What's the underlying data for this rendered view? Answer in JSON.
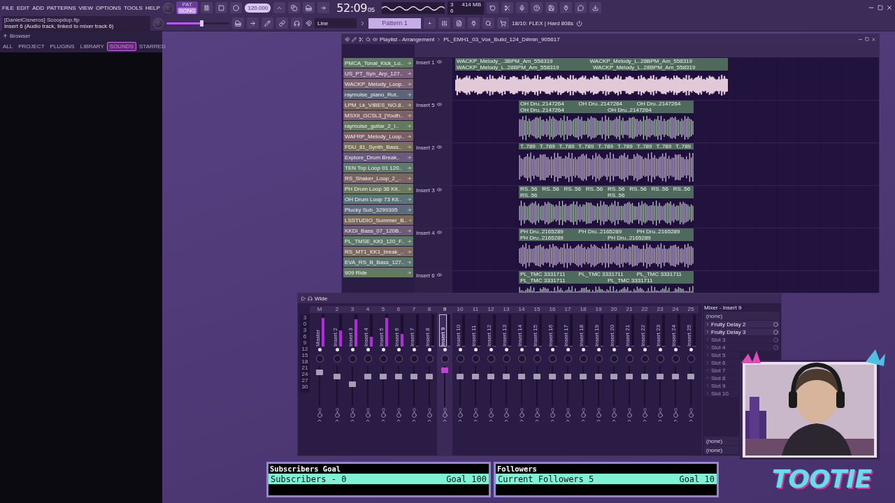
{
  "menu": [
    "FILE",
    "EDIT",
    "ADD",
    "PATTERNS",
    "VIEW",
    "OPTIONS",
    "TOOLS",
    "HELP"
  ],
  "transport": {
    "modes": [
      {
        "label": "PAT",
        "selected": false
      },
      {
        "label": "SONG",
        "selected": true
      }
    ],
    "tempo": "120.000",
    "time": "52:09",
    "time_sub": "05",
    "cpu": "3",
    "memory": "414 MB",
    "voices": "6"
  },
  "hint": {
    "project": "[DanielCisneros] Scoopdup.flp",
    "text": "Insert 6 (Audio track, linked to mixer track 6)"
  },
  "master_volume": {
    "level": 0.55
  },
  "snap": "Line",
  "pattern": "Pattern 1",
  "pattern_add": "+",
  "news": "18/10: FLEX | Hard 808s",
  "browser": {
    "title": "Browser",
    "tabs": [
      {
        "label": "ALL",
        "selected": false
      },
      {
        "label": "PROJECT",
        "selected": false
      },
      {
        "label": "PLUGINS",
        "selected": false
      },
      {
        "label": "LIBRARY",
        "selected": false
      },
      {
        "label": "SOUNDS",
        "selected": true
      },
      {
        "label": "STARRED",
        "selected": false
      }
    ]
  },
  "playlist": {
    "title": "Playlist - Arrangement",
    "project": "PL_EMH1_03_Vox_Build_124_D#min_905617",
    "clips": [
      {
        "name": "PMCA_Tonal_Kick_Lo..",
        "color": "#5f7a63"
      },
      {
        "name": "US_PT_Syn_Arp_127..",
        "color": "#7a5f78"
      },
      {
        "name": "WACKP_Melody_Loop..",
        "color": "#7d6371"
      },
      {
        "name": "raymoise_piano_Rut..",
        "color": "#5d6478"
      },
      {
        "name": "LPM_Lk_VIBES_NO.8..",
        "color": "#7a6560"
      },
      {
        "name": "MSXII_GCSL3_[Youth..",
        "color": "#7c6166"
      },
      {
        "name": "raymoise_guitar_2_I..",
        "color": "#637a5f"
      },
      {
        "name": "WAFRP_Melody_Loop..",
        "color": "#7a5f64"
      },
      {
        "name": "FDU_81_Synth_Bass..",
        "color": "#76705a"
      },
      {
        "name": "Explore_Drum Break..",
        "color": "#6a5b7e"
      },
      {
        "name": "TEN Top Loop 01 120..",
        "color": "#5f7a6a"
      },
      {
        "name": "RS_Shaker_Loop_2_..",
        "color": "#7b6560"
      },
      {
        "name": "PH Drum Loop 36 Kit..",
        "color": "#6b7a5c"
      },
      {
        "name": "OH Drum Loop 73 Kit..",
        "color": "#5c7678"
      },
      {
        "name": "Plucky Sub_3299395",
        "color": "#5f6a7a"
      },
      {
        "name": "LSSTUDIO_Summer_B..",
        "color": "#7a6a5a"
      },
      {
        "name": "KKDI_Bass_07_120B..",
        "color": "#6c5c78"
      },
      {
        "name": "PL_TMSE_Kit3_120_F..",
        "color": "#5c7a66"
      },
      {
        "name": "RS_MT1_KK1_break_..",
        "color": "#7a6a5f"
      },
      {
        "name": "EVA_RS_B_Bass_127..",
        "color": "#5f7572"
      },
      {
        "name": "909 Ride",
        "color": "#627a5f"
      }
    ],
    "tracks": [
      {
        "name": "Insert 1",
        "kind": "long",
        "labels": [
          "WACKP_Melody_..3BPM_Am_558319",
          "WACKP_Melody_L..28BPM_Am_558319",
          "WACKP_Melody_L..28BPM_Am_558319",
          "WACKP_Melody_L..28BPM_Am_558319"
        ]
      },
      {
        "name": "Insert 5",
        "kind": "short",
        "labels": [
          "OH Dru..2147264",
          "OH Dru..2147264",
          "OH Dru..2147264",
          "OH Dru..2147264",
          "OH Dru..2147264"
        ]
      },
      {
        "name": "Insert 2",
        "kind": "short",
        "labels": [
          "T..789",
          "T..789",
          "T..789",
          "T..789",
          "T..789",
          "T..789",
          "T..789",
          "T..789",
          "T..789"
        ]
      },
      {
        "name": "Insert 3",
        "kind": "short",
        "labels": [
          "RS..56",
          "RS..56",
          "RS..56",
          "RS..56",
          "RS..56",
          "RS..56",
          "RS..56",
          "RS..56",
          "RS..56",
          "RS..56"
        ]
      },
      {
        "name": "Insert 4",
        "kind": "short",
        "labels": [
          "PH Dru..2165289",
          "PH Dru..2165289",
          "PH Dru..2165289",
          "PH Dru..2165289",
          "PH Dru..2165289"
        ]
      },
      {
        "name": "Insert 6",
        "kind": "short",
        "labels": [
          "PL_TMC 3331711",
          "PL_TMC 3331711",
          "PL_TMC 3331711",
          "PL_TMC 3331711",
          "PL_TMC 3331711"
        ]
      }
    ]
  },
  "mixer": {
    "preset": "Wide",
    "scale": [
      "3",
      "0",
      "3",
      "6",
      "9",
      "12",
      "15",
      "18",
      "21",
      "24",
      "27",
      "30"
    ],
    "strips": [
      {
        "number": "M",
        "name": "Master",
        "selected": false,
        "meter": {
          "level": 0.9
        },
        "fader": {
          "level": 0.85
        }
      },
      {
        "number": "2",
        "name": "Insert 2",
        "selected": false,
        "meter": {
          "level": 0.5
        },
        "fader": {
          "level": 0.75
        }
      },
      {
        "number": "3",
        "name": "Insert 3",
        "selected": false,
        "meter": {
          "level": 0.85
        },
        "fader": {
          "level": 0.55
        }
      },
      {
        "number": "4",
        "name": "Insert 4",
        "selected": false,
        "meter": {
          "level": 0.3
        },
        "fader": {
          "level": 0.75
        }
      },
      {
        "number": "5",
        "name": "Insert 5",
        "selected": false,
        "meter": {
          "level": 0.9
        },
        "fader": {
          "level": 0.75
        }
      },
      {
        "number": "6",
        "name": "Insert 6",
        "selected": false,
        "meter": {
          "level": 0.4
        },
        "fader": {
          "level": 0.75
        }
      },
      {
        "number": "7",
        "name": "Insert 7",
        "selected": false,
        "meter": {
          "level": 0
        },
        "fader": {
          "level": 0.75
        }
      },
      {
        "number": "8",
        "name": "Insert 8",
        "selected": false,
        "meter": {
          "level": 0
        },
        "fader": {
          "level": 0.75
        }
      },
      {
        "number": "9",
        "name": "Insert 9",
        "selected": true,
        "meter": {
          "level": 0
        },
        "fader": {
          "level": 0.9
        }
      },
      {
        "number": "10",
        "name": "Insert 10",
        "selected": false,
        "meter": {
          "level": 0
        },
        "fader": {
          "level": 0.75
        }
      },
      {
        "number": "11",
        "name": "Insert 11",
        "selected": false,
        "meter": {
          "level": 0
        },
        "fader": {
          "level": 0.75
        }
      },
      {
        "number": "12",
        "name": "Insert 12",
        "selected": false,
        "meter": {
          "level": 0
        },
        "fader": {
          "level": 0.75
        }
      },
      {
        "number": "13",
        "name": "Insert 13",
        "selected": false,
        "meter": {
          "level": 0
        },
        "fader": {
          "level": 0.75
        }
      },
      {
        "number": "14",
        "name": "Insert 14",
        "selected": false,
        "meter": {
          "level": 0
        },
        "fader": {
          "level": 0.75
        }
      },
      {
        "number": "15",
        "name": "Insert 15",
        "selected": false,
        "meter": {
          "level": 0
        },
        "fader": {
          "level": 0.75
        }
      },
      {
        "number": "16",
        "name": "Insert 16",
        "selected": false,
        "meter": {
          "level": 0
        },
        "fader": {
          "level": 0.75
        }
      },
      {
        "number": "17",
        "name": "Insert 17",
        "selected": false,
        "meter": {
          "level": 0
        },
        "fader": {
          "level": 0.75
        }
      },
      {
        "number": "18",
        "name": "Insert 18",
        "selected": false,
        "meter": {
          "level": 0
        },
        "fader": {
          "level": 0.75
        }
      },
      {
        "number": "19",
        "name": "Insert 19",
        "selected": false,
        "meter": {
          "level": 0
        },
        "fader": {
          "level": 0.75
        }
      },
      {
        "number": "20",
        "name": "Insert 20",
        "selected": false,
        "meter": {
          "level": 0
        },
        "fader": {
          "level": 0.75
        }
      },
      {
        "number": "21",
        "name": "Insert 21",
        "selected": false,
        "meter": {
          "level": 0
        },
        "fader": {
          "level": 0.75
        }
      },
      {
        "number": "22",
        "name": "Insert 22",
        "selected": false,
        "meter": {
          "level": 0
        },
        "fader": {
          "level": 0.75
        }
      },
      {
        "number": "23",
        "name": "Insert 23",
        "selected": false,
        "meter": {
          "level": 0
        },
        "fader": {
          "level": 0.75
        }
      },
      {
        "number": "24",
        "name": "Insert 24",
        "selected": false,
        "meter": {
          "level": 0
        },
        "fader": {
          "level": 0.75
        }
      },
      {
        "number": "25",
        "name": "Insert 25",
        "selected": false,
        "meter": {
          "level": 0
        },
        "fader": {
          "level": 0.75
        }
      }
    ],
    "panel": {
      "title": "Mixer - Insert 9",
      "input": "(none)",
      "slots": [
        {
          "kind": "plugin",
          "name": "Fruity Delay 2"
        },
        {
          "kind": "plugin",
          "name": "Fruity Delay 3"
        },
        {
          "kind": "empty",
          "name": "Slot 3"
        },
        {
          "kind": "empty",
          "name": "Slot 4"
        },
        {
          "kind": "empty",
          "name": "Slot 5"
        },
        {
          "kind": "empty",
          "name": "Slot 6"
        },
        {
          "kind": "empty",
          "name": "Slot 7"
        },
        {
          "kind": "empty",
          "name": "Slot 8"
        },
        {
          "kind": "empty",
          "name": "Slot 9"
        },
        {
          "kind": "empty",
          "name": "Slot 10"
        }
      ],
      "outputs": [
        "(none)",
        "(none)"
      ]
    }
  },
  "goals": [
    {
      "title": "Subscribers Goal",
      "current": "Subscribers - 0",
      "goal": "Goal 100"
    },
    {
      "title": "Followers",
      "current": "Current Followers 5",
      "goal": "Goal 10"
    }
  ],
  "logo": "TOOTIE",
  "webcam": {
    "kind": "picture"
  }
}
